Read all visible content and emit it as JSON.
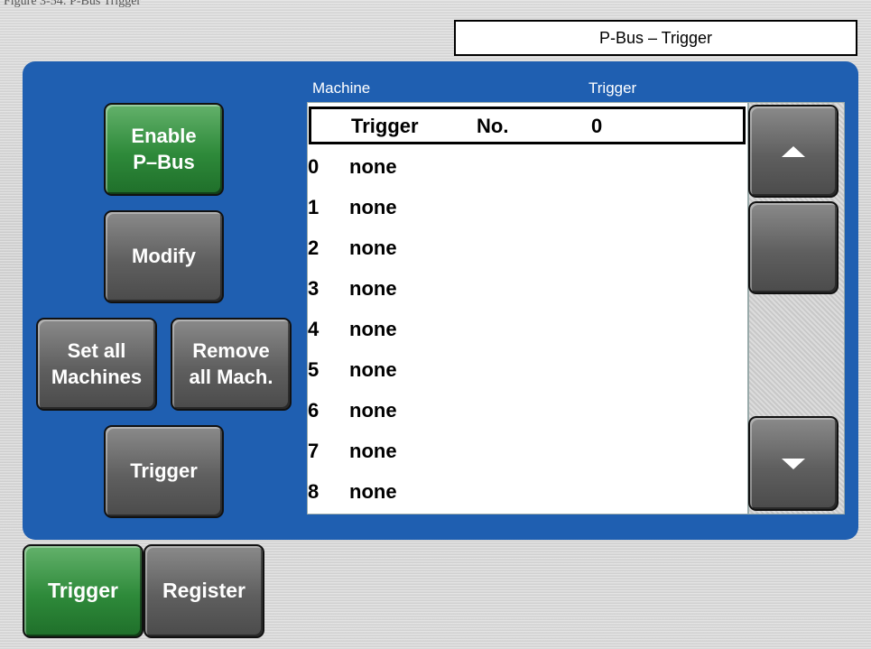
{
  "caption": "Figure 3-54: P-Bus Trigger",
  "window": {
    "title": "P-Bus – Trigger"
  },
  "sidebar": {
    "enable_pbus": "Enable\nP–Bus",
    "modify": "Modify",
    "set_all_machines": "Set all\nMachines",
    "remove_all_mach": "Remove\nall Mach.",
    "trigger": "Trigger"
  },
  "list": {
    "columns": {
      "machine": "Machine",
      "trigger": "Trigger"
    },
    "header": {
      "label": "Trigger",
      "no_label": "No.",
      "number": "0"
    },
    "rows": [
      {
        "index": "0",
        "value": "none"
      },
      {
        "index": "1",
        "value": "none"
      },
      {
        "index": "2",
        "value": "none"
      },
      {
        "index": "3",
        "value": "none"
      },
      {
        "index": "4",
        "value": "none"
      },
      {
        "index": "5",
        "value": "none"
      },
      {
        "index": "6",
        "value": "none"
      },
      {
        "index": "7",
        "value": "none"
      },
      {
        "index": "8",
        "value": "none"
      }
    ]
  },
  "scroll": {
    "up_icon": "triangle-up-icon",
    "down_icon": "triangle-down-icon"
  },
  "tabs": [
    {
      "label": "Trigger",
      "active": true
    },
    {
      "label": "Register",
      "active": false
    }
  ],
  "colors": {
    "panel": "#1f5fb1",
    "active_green": "#2e8a3a",
    "button_grey": "#5f5f5f"
  }
}
